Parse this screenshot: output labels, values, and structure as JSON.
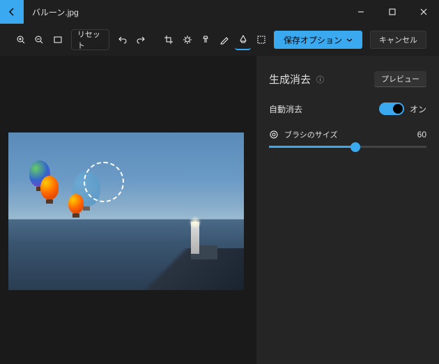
{
  "titlebar": {
    "filename": "バルーン.jpg"
  },
  "toolbar": {
    "reset_label": "リセット",
    "save_label": "保存オプション",
    "cancel_label": "キャンセル"
  },
  "panel": {
    "title": "生成消去",
    "preview_label": "プレビュー",
    "auto_erase_label": "自動消去",
    "toggle_on_label": "オン",
    "brush_size_label": "ブラシのサイズ",
    "brush_size_value": "60"
  }
}
